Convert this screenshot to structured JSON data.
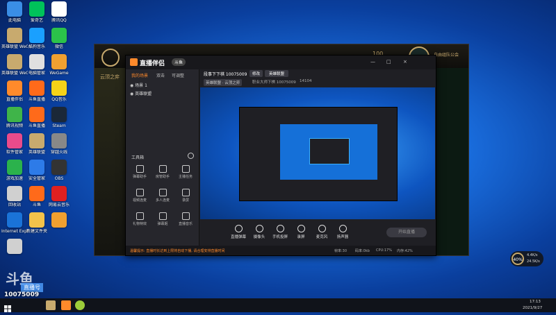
{
  "desktop": {
    "icons": [
      {
        "label": "此电脑",
        "color": "#3a8ee6"
      },
      {
        "label": "爱奇艺",
        "color": "#00c25a"
      },
      {
        "label": "腾讯QQ",
        "color": "#ffffff"
      },
      {
        "label": "英雄联盟 WeGame版",
        "color": "#c8aa6e"
      },
      {
        "label": "酷狗音乐",
        "color": "#1aa0ff"
      },
      {
        "label": "微信",
        "color": "#2bc24a"
      },
      {
        "label": "英雄联盟 WeGame版",
        "color": "#c8aa6e"
      },
      {
        "label": "电脑管家",
        "color": "#e0e0e0"
      },
      {
        "label": "WeGame",
        "color": "#f0a030"
      },
      {
        "label": "直播伴侣",
        "color": "#ff8a2b"
      },
      {
        "label": "斗鱼直播",
        "color": "#ff6a1a"
      },
      {
        "label": "QQ音乐",
        "color": "#f6d318"
      },
      {
        "label": "腾讯视频",
        "color": "#3fb449"
      },
      {
        "label": "斗鱼直播",
        "color": "#ff6a1a"
      },
      {
        "label": "Steam",
        "color": "#1b2838"
      },
      {
        "label": "软件管家",
        "color": "#e94b8b"
      },
      {
        "label": "英雄联盟",
        "color": "#c8aa6e"
      },
      {
        "label": "穿越火线",
        "color": "#888888"
      },
      {
        "label": "游戏加速",
        "color": "#2bb24c"
      },
      {
        "label": "安全管家",
        "color": "#2d7be8"
      },
      {
        "label": "OBS",
        "color": "#333333"
      },
      {
        "label": "回收站",
        "color": "#d0d0d0"
      },
      {
        "label": "斗鱼",
        "color": "#ff6a1a"
      },
      {
        "label": "网易云音乐",
        "color": "#e02020"
      },
      {
        "label": "Internet Explorer",
        "color": "#1a73d8"
      },
      {
        "label": "新建文件夹",
        "color": "#f3c34a"
      },
      {
        "label": "",
        "color": "#f0a030"
      },
      {
        "label": "",
        "color": "#d0d0d0"
      }
    ],
    "watermark_logo": "斗鱼",
    "watermark_sub": "直播号",
    "room_id": "10075009"
  },
  "game": {
    "left_title": "云顶之弈",
    "gold_value": "100",
    "right_title": "自由组队公会"
  },
  "app": {
    "logo": "直播伴侣",
    "logo_badge": "斗鱼",
    "window_controls": [
      "—",
      "□",
      "×"
    ],
    "tabs": [
      "我的场景",
      "双击",
      "可调整"
    ],
    "scenes": [
      {
        "name": "场景 1"
      },
      {
        "name": "英雄联盟"
      }
    ],
    "toolbox_title": "工具箱",
    "tools": [
      {
        "label": "弹幕助手"
      },
      {
        "label": "房管助手"
      },
      {
        "label": "主播任务"
      },
      {
        "label": "视频连麦"
      },
      {
        "label": "多人连麦"
      },
      {
        "label": "录屏"
      },
      {
        "label": "礼物特效"
      },
      {
        "label": "弹幕姬"
      },
      {
        "label": "直播音乐"
      }
    ],
    "header": {
      "room_title": "段事下下棋 10075009",
      "edit": "修改",
      "category": "英雄联盟",
      "tag1": "英雄联盟 · 云顶之弈",
      "tag2": "职业大师下棋 10075009",
      "fans": "14104"
    },
    "bottom": [
      {
        "label": "直播弹幕"
      },
      {
        "label": "摄像头"
      },
      {
        "label": "手机投屏"
      },
      {
        "label": "录屏"
      },
      {
        "label": "麦克风"
      },
      {
        "label": "扬声器"
      }
    ],
    "start_button": "开始直播",
    "status_text": "温馨提示: 直播时长达到上限将自动下播, 请合理安排直播时间",
    "status_right": [
      "帧率:30",
      "码率:0kb",
      "CPU:17%",
      "内存:42%"
    ]
  },
  "overlay": {
    "percent": "40%",
    "speed_up": "4.4K/s",
    "speed_down": "24.5K/s"
  },
  "taskbar": {
    "time": "17:13",
    "date": "2021/9/27"
  }
}
